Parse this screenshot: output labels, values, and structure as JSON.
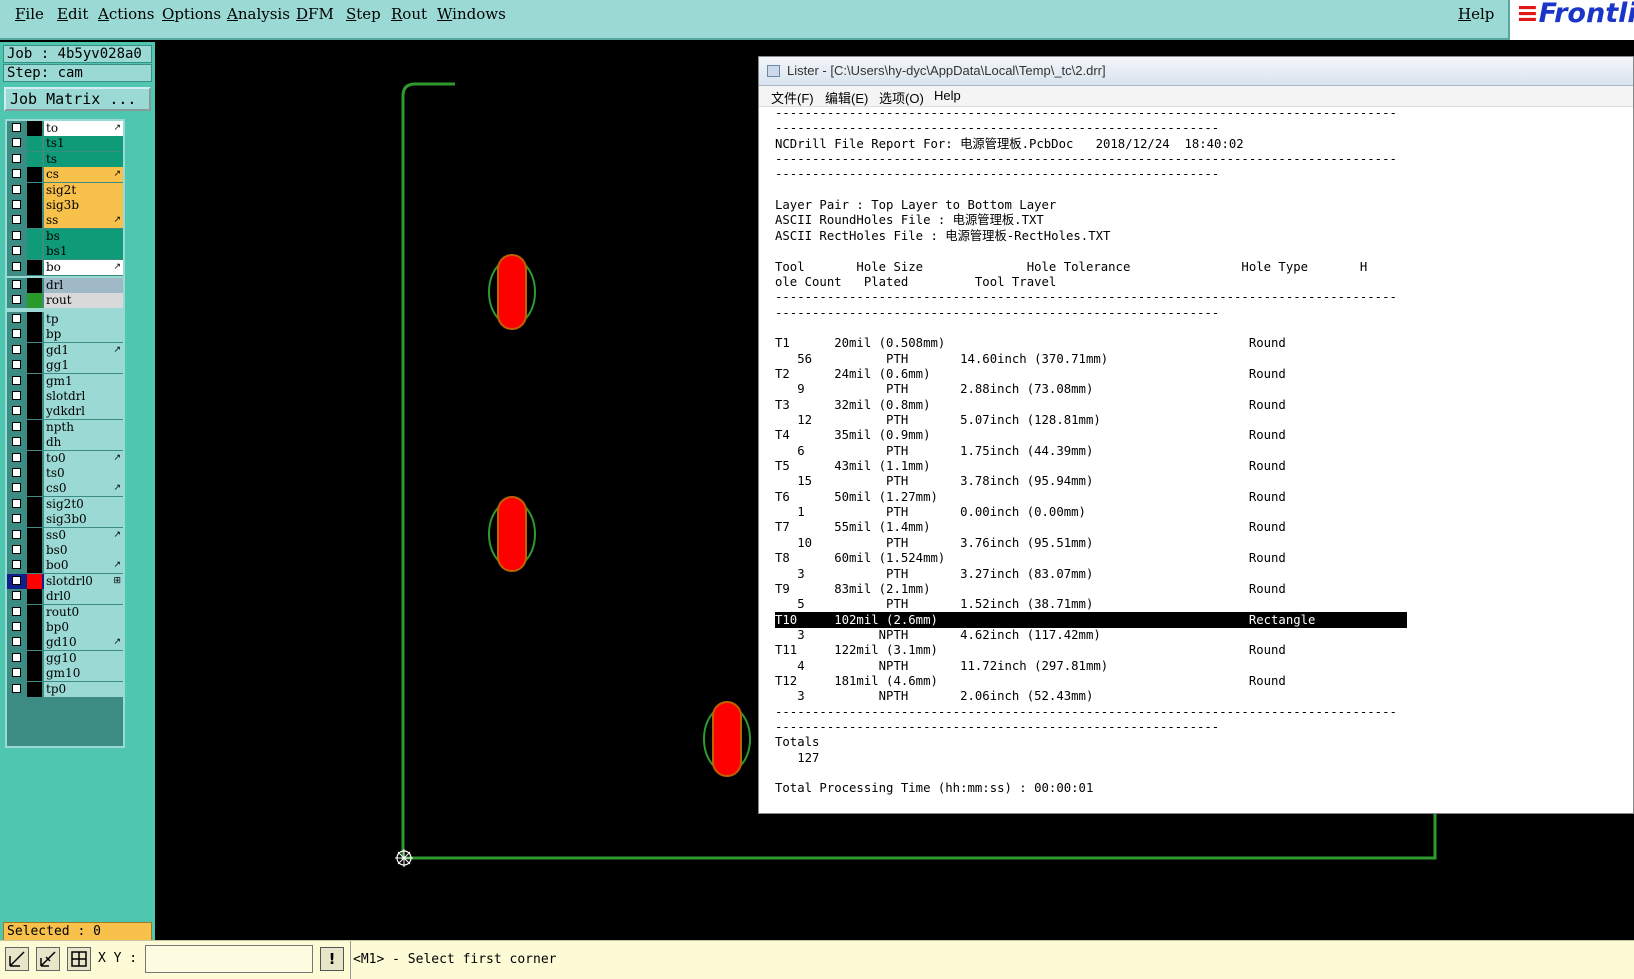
{
  "menu": {
    "items": [
      "File",
      "Edit",
      "Actions",
      "Options",
      "Analysis",
      "DFM",
      "Step",
      "Rout",
      "Windows"
    ],
    "help": "Help",
    "logo_text": "Frontli"
  },
  "job": {
    "job_label": "Job : 4b5yv028a0",
    "step_label": "Step: cam",
    "matrix_button": "Job Matrix ..."
  },
  "layers": {
    "group1": [
      {
        "name": "to",
        "bg": "#ffffff",
        "color": "#000000",
        "flag": "↗"
      },
      {
        "name": "ts1",
        "bg": "#0f9b77",
        "color": "#0f9b77",
        "flag": ""
      },
      {
        "name": "ts",
        "bg": "#0f9b77",
        "color": "#0f9b77",
        "flag": ""
      },
      {
        "name": "cs",
        "bg": "#f7c14b",
        "color": "#000000",
        "flag": "↗"
      },
      {
        "name": "sig2t",
        "bg": "#f7c14b",
        "color": "#000000",
        "flag": ""
      },
      {
        "name": "sig3b",
        "bg": "#f7c14b",
        "color": "#000000",
        "flag": ""
      },
      {
        "name": "ss",
        "bg": "#f7c14b",
        "color": "#000000",
        "flag": "↗"
      },
      {
        "name": "bs",
        "bg": "#0f9b77",
        "color": "#0f9b77",
        "flag": ""
      },
      {
        "name": "bs1",
        "bg": "#0f9b77",
        "color": "#0f9b77",
        "flag": ""
      },
      {
        "name": "bo",
        "bg": "#ffffff",
        "color": "#000000",
        "flag": "↗"
      }
    ],
    "group2": [
      {
        "name": "drl",
        "bg": "#9fb9c7",
        "color": "#000000",
        "flag": ""
      },
      {
        "name": "rout",
        "bg": "#d9d9d9",
        "color": "#2a9a2a",
        "flag": ""
      }
    ],
    "group3": [
      {
        "name": "tp",
        "bg": "#9ad9d4",
        "color": "#000000",
        "flag": ""
      },
      {
        "name": "bp",
        "bg": "#9ad9d4",
        "color": "#000000",
        "flag": ""
      },
      {
        "name": "gd1",
        "bg": "#9ad9d4",
        "color": "#000000",
        "flag": "↗"
      },
      {
        "name": "gg1",
        "bg": "#9ad9d4",
        "color": "#000000",
        "flag": ""
      },
      {
        "name": "gm1",
        "bg": "#9ad9d4",
        "color": "#000000",
        "flag": ""
      },
      {
        "name": "slotdrl",
        "bg": "#9ad9d4",
        "color": "#000000",
        "flag": ""
      },
      {
        "name": "ydkdrl",
        "bg": "#9ad9d4",
        "color": "#000000",
        "flag": ""
      },
      {
        "name": "npth",
        "bg": "#9ad9d4",
        "color": "#000000",
        "flag": ""
      },
      {
        "name": "dh",
        "bg": "#9ad9d4",
        "color": "#000000",
        "flag": ""
      },
      {
        "name": "to0",
        "bg": "#9ad9d4",
        "color": "#000000",
        "flag": "↗"
      },
      {
        "name": "ts0",
        "bg": "#9ad9d4",
        "color": "#000000",
        "flag": ""
      },
      {
        "name": "cs0",
        "bg": "#9ad9d4",
        "color": "#000000",
        "flag": "↗"
      },
      {
        "name": "sig2t0",
        "bg": "#9ad9d4",
        "color": "#000000",
        "flag": ""
      },
      {
        "name": "sig3b0",
        "bg": "#9ad9d4",
        "color": "#000000",
        "flag": ""
      },
      {
        "name": "ss0",
        "bg": "#9ad9d4",
        "color": "#000000",
        "flag": "↗"
      },
      {
        "name": "bs0",
        "bg": "#9ad9d4",
        "color": "#000000",
        "flag": ""
      },
      {
        "name": "bo0",
        "bg": "#9ad9d4",
        "color": "#000000",
        "flag": "↗"
      },
      {
        "name": "slotdrl0",
        "bg": "#9ad9d4",
        "color": "#ff0000",
        "flag": "⊞",
        "selected": true
      },
      {
        "name": "drl0",
        "bg": "#9ad9d4",
        "color": "#000000",
        "flag": ""
      },
      {
        "name": "rout0",
        "bg": "#9ad9d4",
        "color": "#000000",
        "flag": ""
      },
      {
        "name": "bp0",
        "bg": "#9ad9d4",
        "color": "#000000",
        "flag": ""
      },
      {
        "name": "gd10",
        "bg": "#9ad9d4",
        "color": "#000000",
        "flag": "↗"
      },
      {
        "name": "gg10",
        "bg": "#9ad9d4",
        "color": "#000000",
        "flag": ""
      },
      {
        "name": "gm10",
        "bg": "#9ad9d4",
        "color": "#000000",
        "flag": ""
      },
      {
        "name": "tp0",
        "bg": "#9ad9d4",
        "color": "#000000",
        "flag": ""
      }
    ]
  },
  "selected_label": "Selected : 0",
  "bottom": {
    "xy_label": "X Y :",
    "xy_value": "",
    "warn_symbol": "!",
    "status_message": "<M1> - Select first corner"
  },
  "lister": {
    "title": "Lister - [C:\\Users\\hy-dyc\\AppData\\Local\\Temp\\_tc\\2.drr]",
    "menu": [
      "文件(F)",
      "编辑(E)",
      "选项(O)",
      "Help"
    ],
    "lines": [
      "------------------------------------------------------------------------------------",
      "------------------------------------------------------------",
      "NCDrill File Report For: 电源管理板.PcbDoc   2018/12/24  18:40:02",
      "------------------------------------------------------------------------------------",
      "------------------------------------------------------------",
      "",
      "Layer Pair : Top Layer to Bottom Layer",
      "ASCII RoundHoles File : 电源管理板.TXT",
      "ASCII RectHoles File : 电源管理板-RectHoles.TXT",
      "",
      "Tool       Hole Size              Hole Tolerance               Hole Type       H",
      "ole Count   Plated         Tool Travel",
      "------------------------------------------------------------------------------------",
      "------------------------------------------------------------",
      "",
      "T1      20mil (0.508mm)                                         Round",
      "   56          PTH       14.60inch (370.71mm)",
      "T2      24mil (0.6mm)                                           Round",
      "   9           PTH       2.88inch (73.08mm)",
      "T3      32mil (0.8mm)                                           Round",
      "   12          PTH       5.07inch (128.81mm)",
      "T4      35mil (0.9mm)                                           Round",
      "   6           PTH       1.75inch (44.39mm)",
      "T5      43mil (1.1mm)                                           Round",
      "   15          PTH       3.78inch (95.94mm)",
      "T6      50mil (1.27mm)                                          Round",
      "   1           PTH       0.00inch (0.00mm)",
      "T7      55mil (1.4mm)                                           Round",
      "   10          PTH       3.76inch (95.51mm)",
      "T8      60mil (1.524mm)                                         Round",
      "   3           PTH       3.27inch (83.07mm)",
      "T9      83mil (2.1mm)                                           Round",
      "   5           PTH       1.52inch (38.71mm)",
      "T10     102mil (2.6mm)                                          Rectangle",
      "   3          NPTH       4.62inch (117.42mm)",
      "T11     122mil (3.1mm)                                          Round",
      "   4          NPTH       11.72inch (297.81mm)",
      "T12     181mil (4.6mm)                                          Round",
      "   3          NPTH       2.06inch (52.43mm)",
      "------------------------------------------------------------------------------------",
      "------------------------------------------------------------",
      "Totals",
      "   127",
      "",
      "Total Processing Time (hh:mm:ss) : 00:00:01"
    ],
    "highlight_index": 33
  },
  "colors": {
    "board_outline": "#2e9a2e",
    "pad_fill": "#ff0000",
    "panel_bg": "#4fc7b0",
    "menubar_bg": "#9ad9d4"
  }
}
